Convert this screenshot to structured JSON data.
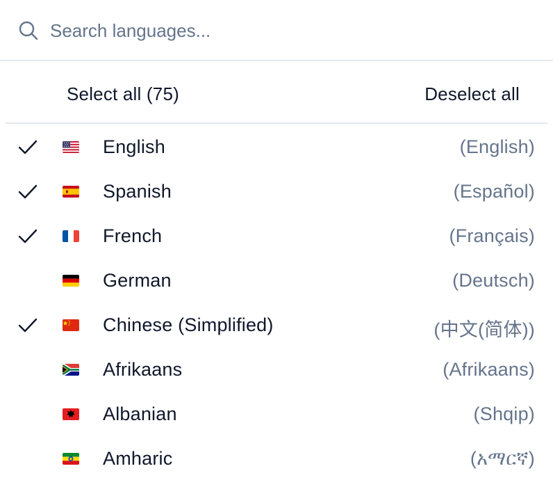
{
  "search": {
    "placeholder": "Search languages..."
  },
  "actions": {
    "select_all": "Select all (75)",
    "deselect_all": "Deselect all"
  },
  "colors": {
    "text": "#0f172a",
    "muted": "#64748b",
    "divider": "#e2e8f0"
  },
  "languages": [
    {
      "name": "English",
      "native": "(English)",
      "selected": true,
      "flag": "us-flag-icon"
    },
    {
      "name": "Spanish",
      "native": "(Español)",
      "selected": true,
      "flag": "es-flag-icon"
    },
    {
      "name": "French",
      "native": "(Français)",
      "selected": true,
      "flag": "fr-flag-icon"
    },
    {
      "name": "German",
      "native": "(Deutsch)",
      "selected": false,
      "flag": "de-flag-icon"
    },
    {
      "name": "Chinese (Simplified)",
      "native": "(中文(简体))",
      "selected": true,
      "flag": "cn-flag-icon"
    },
    {
      "name": "Afrikaans",
      "native": "(Afrikaans)",
      "selected": false,
      "flag": "za-flag-icon"
    },
    {
      "name": "Albanian",
      "native": "(Shqip)",
      "selected": false,
      "flag": "al-flag-icon"
    },
    {
      "name": "Amharic",
      "native": "(አማርኛ)",
      "selected": false,
      "flag": "et-flag-icon"
    }
  ]
}
